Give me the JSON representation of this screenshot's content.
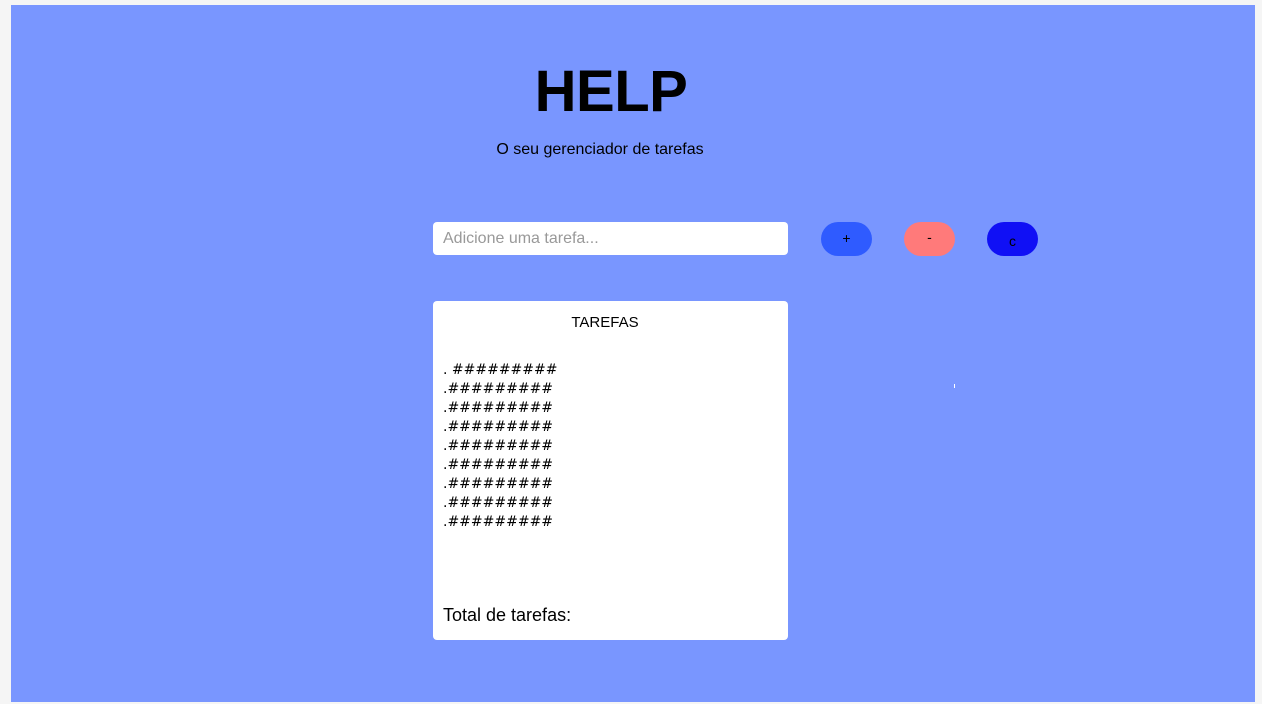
{
  "header": {
    "title": "HELP",
    "subtitle": "O seu gerenciador de tarefas"
  },
  "form": {
    "placeholder": "Adicione uma tarefa...",
    "value": "",
    "add_label": "+",
    "remove_label": "-",
    "clear_label": "c"
  },
  "tasks": {
    "heading": "TAREFAS",
    "items": [
      ". #########",
      ".#########",
      ".#########",
      ".#########",
      ".#########",
      ".#########",
      ".#########",
      ".#########",
      ".#########"
    ],
    "total_label": "Total de tarefas:",
    "total_count": ""
  },
  "colors": {
    "background": "#7996ff",
    "add_button": "#2f5bff",
    "remove_button": "#ff7a7a",
    "clear_button": "#1010f5",
    "panel": "#ffffff"
  }
}
